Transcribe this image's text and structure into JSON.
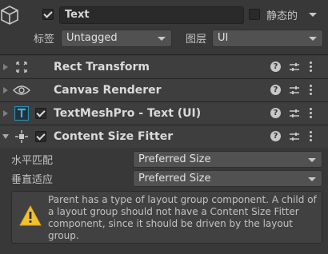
{
  "gameobject": {
    "active": true,
    "name": "Text",
    "static_label": "静态的",
    "static_checked": false,
    "tag_label": "标签",
    "tag_value": "Untagged",
    "layer_label": "图层",
    "layer_value": "UI"
  },
  "components": [
    {
      "title": "Rect Transform",
      "icon": "rect-transform-icon",
      "expanded": false,
      "has_toggle": false
    },
    {
      "title": "Canvas Renderer",
      "icon": "eye-icon",
      "expanded": false,
      "has_toggle": false
    },
    {
      "title": "TextMeshPro - Text (UI)",
      "icon": "textmeshpro-icon",
      "expanded": false,
      "has_toggle": true,
      "enabled": true
    },
    {
      "title": "Content Size Fitter",
      "icon": "content-size-fitter-icon",
      "expanded": true,
      "has_toggle": true,
      "enabled": true
    }
  ],
  "content_size_fitter": {
    "horizontal_label": "水平匹配",
    "horizontal_value": "Preferred Size",
    "vertical_label": "垂直适应",
    "vertical_value": "Preferred Size",
    "warning": "Parent has a type of layout group component. A child of a layout group should not have a Content Size Fitter component, since it should be driven by the layout group.",
    "warning_icon": "warning-icon"
  },
  "header_icons": {
    "help": "?",
    "help_icon": "help-icon",
    "presets_icon": "presets-icon",
    "menu_icon": "kebab-menu-icon"
  },
  "colors": {
    "background": "#383838",
    "row": "#3e3e3e",
    "warning_yellow": "#f2c12e",
    "tmp_blue": "#2a8fb5"
  }
}
